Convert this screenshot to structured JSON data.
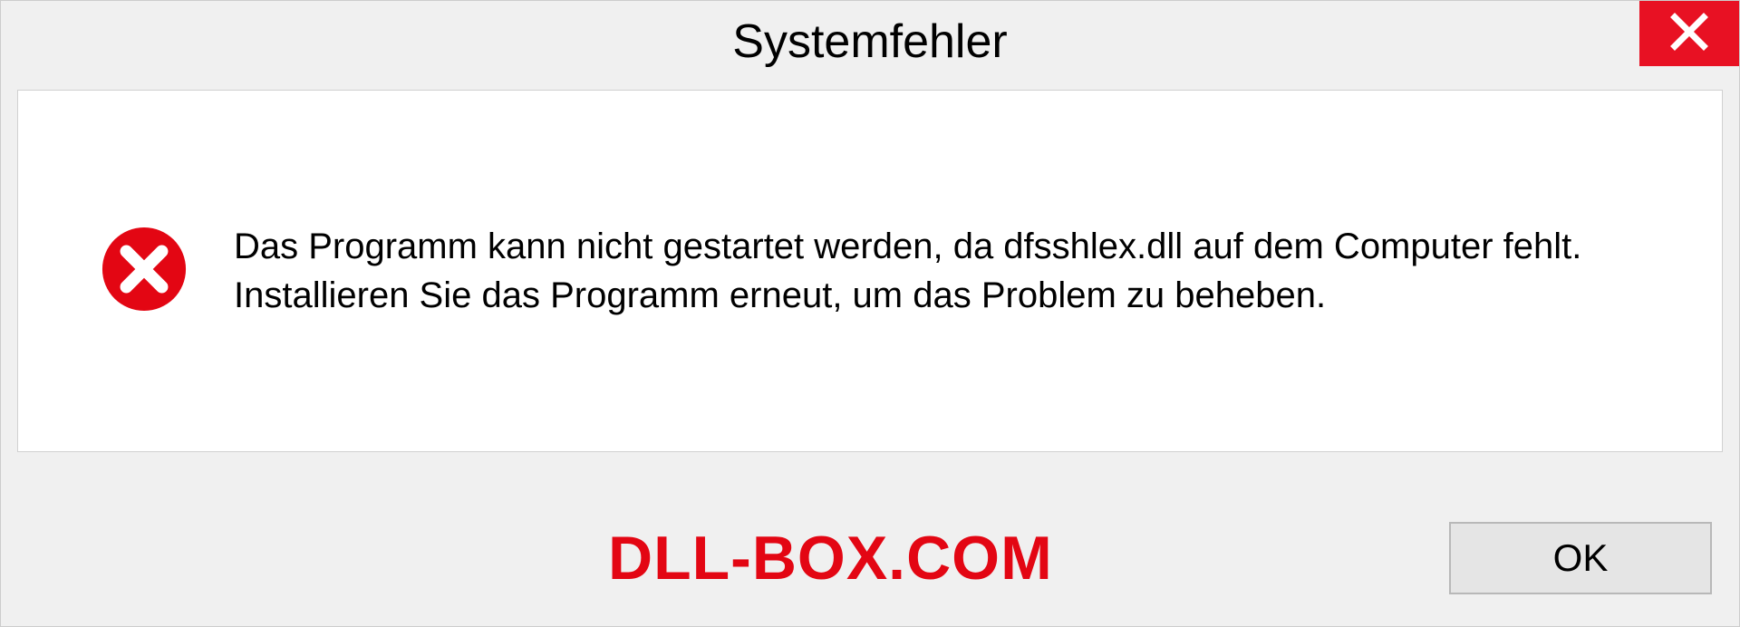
{
  "dialog": {
    "title": "Systemfehler",
    "message": "Das Programm kann nicht gestartet werden, da dfsshlex.dll auf dem Computer fehlt. Installieren Sie das Programm erneut, um das Problem zu beheben.",
    "ok_label": "OK"
  },
  "watermark": "DLL-BOX.COM"
}
